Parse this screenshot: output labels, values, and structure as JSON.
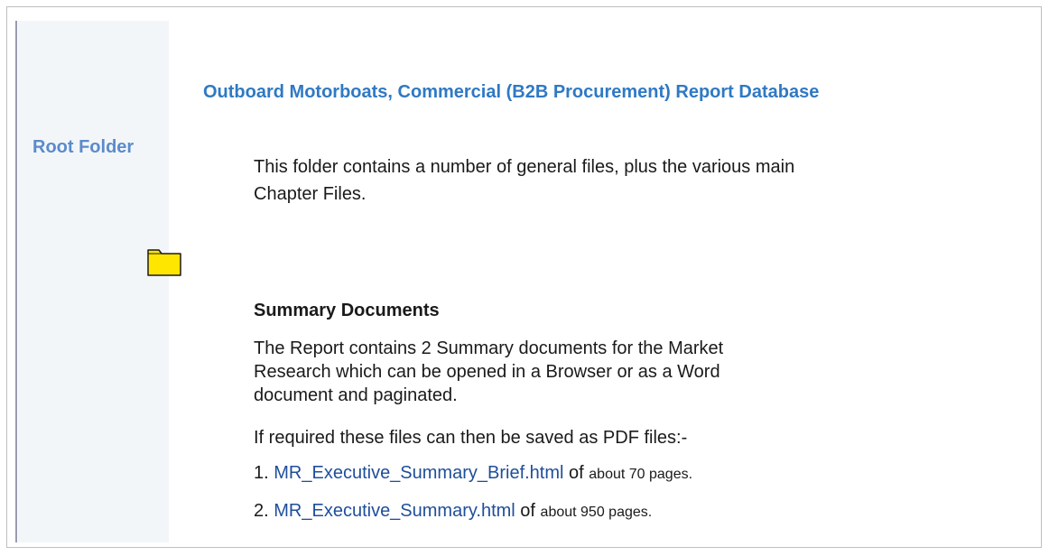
{
  "sidebar": {
    "title": "Root Folder",
    "folder_icon": "folder-icon"
  },
  "main": {
    "title": "Outboard Motorboats, Commercial (B2B Procurement) Report Database",
    "intro": "This folder contains a number of general files, plus the various main Chapter Files.",
    "summary_heading": "Summary Documents",
    "summary_text": "The Report contains 2 Summary documents for the Market Research which can be opened in a Browser or as a Word document and paginated.",
    "pdf_note": "If required these files can then be saved as PDF files:-",
    "files": [
      {
        "number": "1.",
        "name": "MR_Executive_Summary_Brief.html",
        "of": "of",
        "pages": "about 70 pages."
      },
      {
        "number": "2.",
        "name": "MR_Executive_Summary.html",
        "of": "of",
        "pages": "about 950 pages."
      }
    ]
  },
  "colors": {
    "sidebar_bg": "#f3f6f9",
    "title_blue": "#2f79c4",
    "sidebar_title_blue": "#5b8bcb",
    "link_blue": "#1f4e9a",
    "folder_yellow": "#ffe600"
  }
}
